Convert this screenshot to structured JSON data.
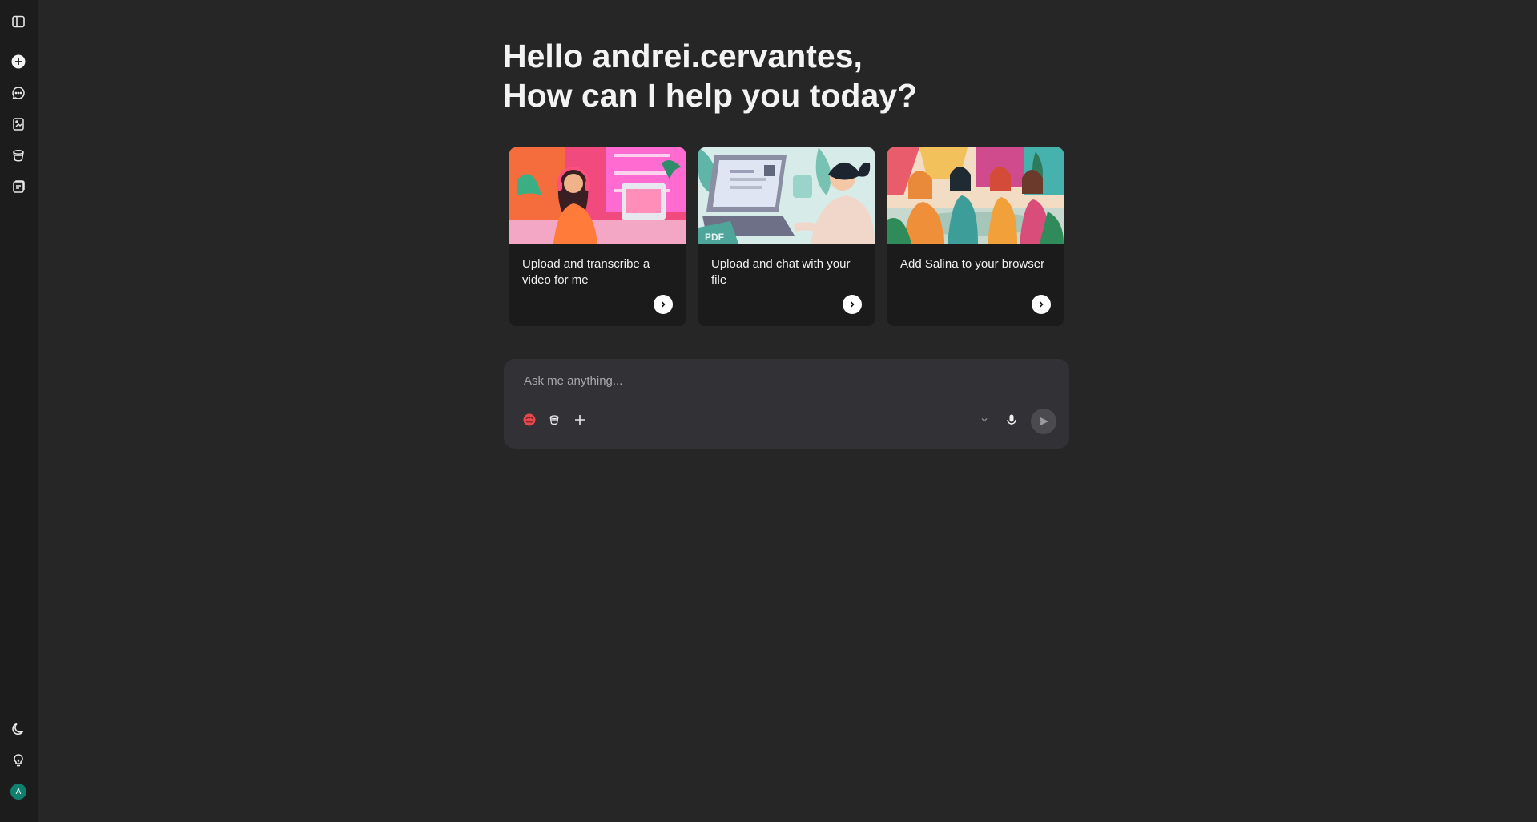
{
  "greeting": {
    "line1": "Hello andrei.cervantes,",
    "line2": "How can I help you today?"
  },
  "cards": [
    {
      "label": "Upload and transcribe a video for me",
      "icon": "chevron-right-icon"
    },
    {
      "label": "Upload and chat with your file",
      "icon": "chevron-right-icon"
    },
    {
      "label": "Add Salina to your browser",
      "icon": "chevron-right-icon"
    }
  ],
  "composer": {
    "placeholder": "Ask me anything...",
    "tools": [
      "brain-icon",
      "bucket-icon",
      "plus-icon"
    ],
    "right_tools": [
      "chevron-down-icon",
      "microphone-icon",
      "send-icon"
    ]
  },
  "sidebar": {
    "icons": [
      "sidebar-toggle-icon",
      "new-chat-icon",
      "chat-icon",
      "notes-icon",
      "bucket-icon",
      "documents-icon"
    ],
    "bottom_icons": [
      "moon-icon",
      "lightbulb-icon"
    ],
    "avatar_initial": "A"
  },
  "colors": {
    "background": "#262626",
    "sidebar": "#1c1c1c",
    "card": "#1b1b1b",
    "composer": "#323236",
    "avatar": "#10806e"
  }
}
